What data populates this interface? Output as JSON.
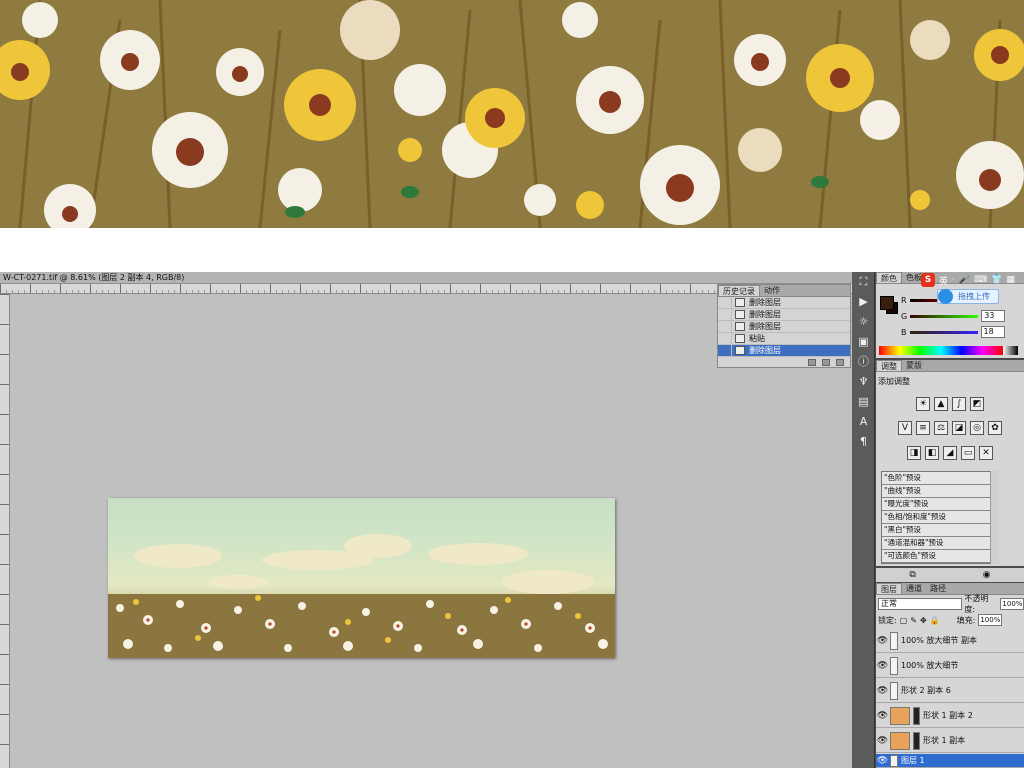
{
  "document_tab": "W-CT-0271.tif @ 8.61% (图层 2 副本 4, RGB/8)",
  "history_panel": {
    "tabs": [
      "历史记录",
      "动作"
    ],
    "items": [
      {
        "label": "删除图层",
        "selected": false
      },
      {
        "label": "删除图层",
        "selected": false
      },
      {
        "label": "删除图层",
        "selected": false
      },
      {
        "label": "粘贴",
        "selected": false
      },
      {
        "label": "删除图层",
        "selected": true
      }
    ]
  },
  "color_panel": {
    "tabs": [
      "颜色",
      "色板"
    ],
    "r_label": "R",
    "g_label": "G",
    "b_label": "B",
    "g_value": "33",
    "b_value": "18"
  },
  "ime_toolbar": {
    "brand": "S",
    "lang": "英",
    "upload_tip": "拖拽上传"
  },
  "adjustments_panel": {
    "tabs": [
      "调整",
      "蒙版"
    ],
    "heading": "添加调整",
    "presets": [
      "\"色阶\"预设",
      "\"曲线\"预设",
      "\"曝光度\"预设",
      "\"色相/饱和度\"预设",
      "\"黑白\"预设",
      "\"通道混和器\"预设",
      "\"可选颜色\"预设"
    ]
  },
  "layers_panel": {
    "tabs": [
      "图层",
      "通道",
      "路径"
    ],
    "blend_mode": "正常",
    "opacity_label": "不透明度:",
    "opacity_value": "100%",
    "lock_label": "锁定:",
    "fill_label": "填充:",
    "fill_value": "100%",
    "layers": [
      {
        "name": "100% 放大细节 副本",
        "selected": false
      },
      {
        "name": "100% 放大细节",
        "selected": false
      },
      {
        "name": "形状 2 副本 6",
        "selected": false
      },
      {
        "name": "形状 1 副本 2",
        "selected": false
      },
      {
        "name": "形状 1 副本",
        "selected": false
      },
      {
        "name": "图层 1",
        "selected": true
      }
    ]
  },
  "colors": {
    "selection": "#2f6cd0",
    "workspace": "#c0c0c0",
    "layer_thumb": "#e9a25a"
  }
}
